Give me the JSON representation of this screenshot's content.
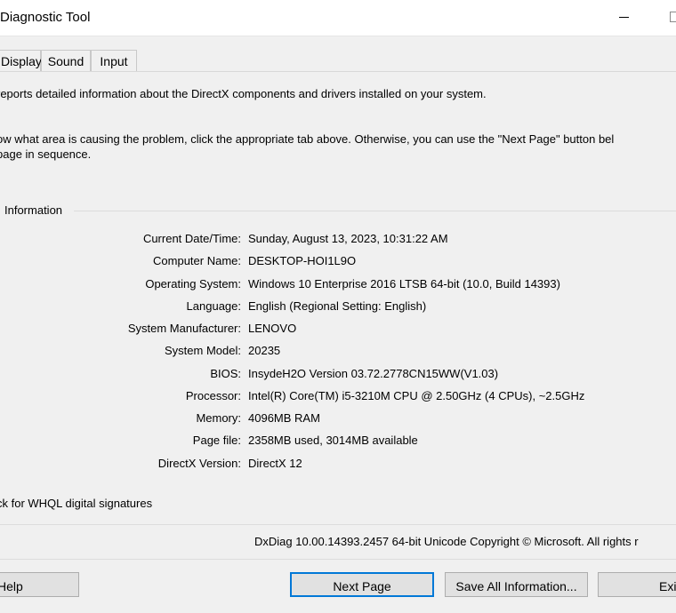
{
  "window": {
    "title": "Diagnostic Tool"
  },
  "tabs": [
    {
      "label": "Display"
    },
    {
      "label": "Sound"
    },
    {
      "label": "Input"
    }
  ],
  "intro": {
    "line1": "reports detailed information about the DirectX components and drivers installed on your system.",
    "line2": "ow what area is causing the problem, click the appropriate tab above.  Otherwise, you can use the \"Next Page\" button bel",
    "line3": " page in sequence."
  },
  "system_info": {
    "group_title": "Information",
    "rows": [
      {
        "label": "Current Date/Time:",
        "value": "Sunday, August 13, 2023, 10:31:22 AM"
      },
      {
        "label": "Computer Name:",
        "value": "DESKTOP-HOI1L9O"
      },
      {
        "label": "Operating System:",
        "value": "Windows 10 Enterprise 2016 LTSB 64-bit (10.0, Build 14393)"
      },
      {
        "label": "Language:",
        "value": "English (Regional Setting: English)"
      },
      {
        "label": "System Manufacturer:",
        "value": "LENOVO"
      },
      {
        "label": "System Model:",
        "value": "20235"
      },
      {
        "label": "BIOS:",
        "value": "InsydeH2O Version 03.72.2778CN15WW(V1.03)"
      },
      {
        "label": "Processor:",
        "value": "Intel(R) Core(TM) i5-3210M CPU @ 2.50GHz (4 CPUs), ~2.5GHz"
      },
      {
        "label": "Memory:",
        "value": "4096MB RAM"
      },
      {
        "label": "Page file:",
        "value": "2358MB used, 3014MB available"
      },
      {
        "label": "DirectX Version:",
        "value": "DirectX 12"
      }
    ]
  },
  "whql_check": {
    "label": "ck for WHQL digital signatures"
  },
  "footer": {
    "version_text": "DxDiag 10.00.14393.2457 64-bit Unicode  Copyright © Microsoft. All rights r"
  },
  "buttons": {
    "help": "Help",
    "next_page": "Next Page",
    "save_all": "Save All Information...",
    "exit": "Exit"
  }
}
